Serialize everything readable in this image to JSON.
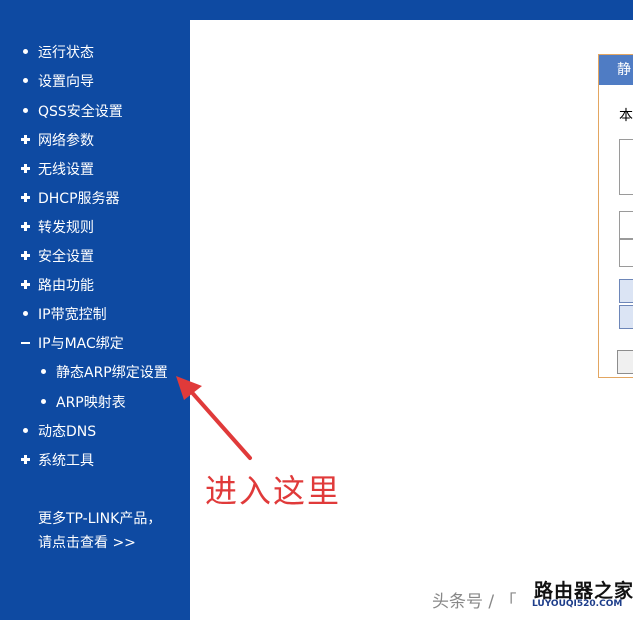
{
  "sidebar": {
    "items": [
      {
        "label": "运行状态",
        "bullet": "dot"
      },
      {
        "label": "设置向导",
        "bullet": "dot"
      },
      {
        "label": "QSS安全设置",
        "bullet": "dot"
      },
      {
        "label": "网络参数",
        "bullet": "plus"
      },
      {
        "label": "无线设置",
        "bullet": "plus"
      },
      {
        "label": "DHCP服务器",
        "bullet": "plus"
      },
      {
        "label": "转发规则",
        "bullet": "plus"
      },
      {
        "label": "安全设置",
        "bullet": "plus"
      },
      {
        "label": "路由功能",
        "bullet": "plus"
      },
      {
        "label": "IP带宽控制",
        "bullet": "dot"
      },
      {
        "label": "IP与MAC绑定",
        "bullet": "minus"
      },
      {
        "label": "静态ARP绑定设置",
        "bullet": "dot"
      },
      {
        "label": "ARP映射表",
        "bullet": "dot"
      },
      {
        "label": "动态DNS",
        "bullet": "dot"
      },
      {
        "label": "系统工具",
        "bullet": "plus"
      }
    ],
    "promo_line1": "更多TP-LINK产品，",
    "promo_line2": "请点击查看 >>"
  },
  "dialog": {
    "title_fragment": "静",
    "text_fragment": "本"
  },
  "annotation": {
    "text": "进入这里",
    "color": "#e03a3a"
  },
  "watermark": {
    "text": "头条号 / 「",
    "logo_main": "路由器之家",
    "logo_sub": "LUYOUQI520.COM"
  },
  "colors": {
    "sidebar_bg": "#0e4aa2",
    "dialog_header": "#4f7cc4",
    "dialog_border": "#e3a661"
  }
}
